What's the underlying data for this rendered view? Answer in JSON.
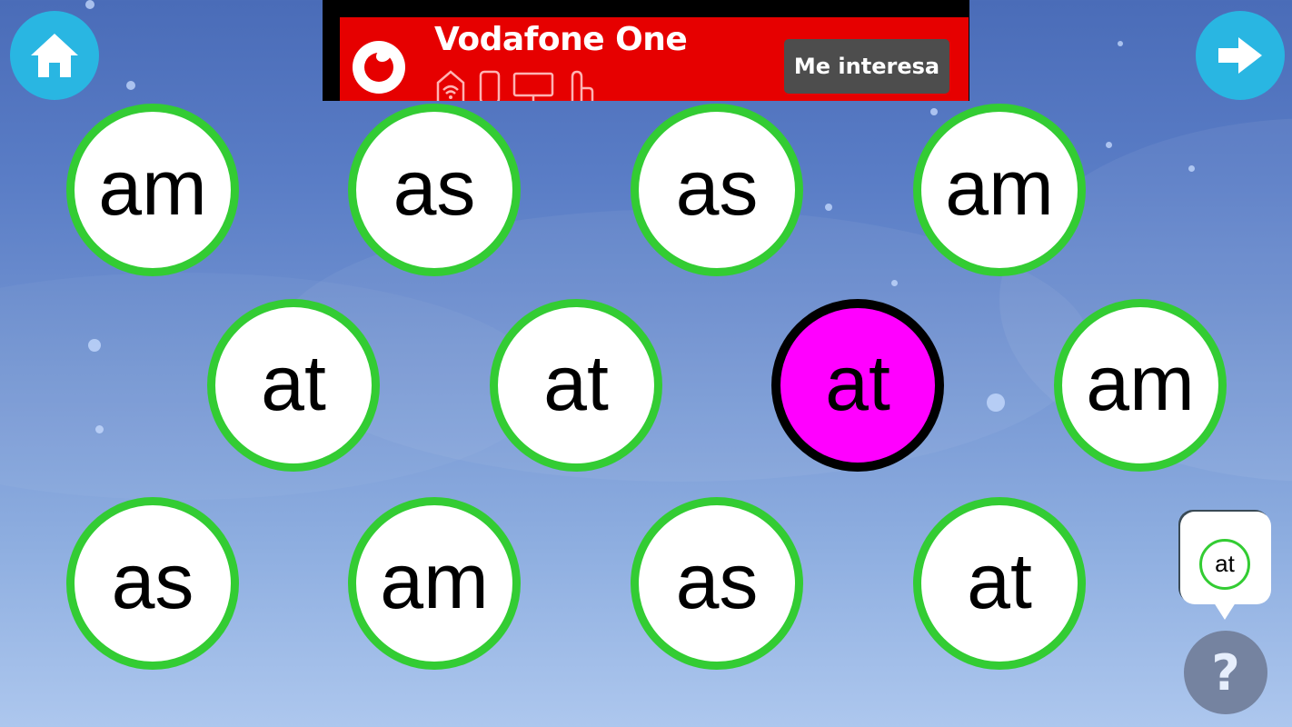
{
  "nav": {
    "home_icon": "home-icon",
    "next_icon": "arrow-right-icon"
  },
  "ad": {
    "brand_icon": "vodafone-logo-icon",
    "title": "Vodafone One",
    "product_icons": [
      "wifi-router-icon",
      "mobile-phone-icon",
      "tv-icon",
      "landline-phone-icon"
    ],
    "cta_label": "Me interesa",
    "colors": {
      "background": "#e60000",
      "cta": "#4d4d4d"
    }
  },
  "board": {
    "rows": [
      [
        {
          "label": "am",
          "selected": false
        },
        {
          "label": "as",
          "selected": false
        },
        {
          "label": "as",
          "selected": false
        },
        {
          "label": "am",
          "selected": false
        }
      ],
      [
        {
          "label": "at",
          "selected": false
        },
        {
          "label": "at",
          "selected": false
        },
        {
          "label": "at",
          "selected": true
        },
        {
          "label": "am",
          "selected": false
        }
      ],
      [
        {
          "label": "as",
          "selected": false
        },
        {
          "label": "am",
          "selected": false
        },
        {
          "label": "as",
          "selected": false
        },
        {
          "label": "at",
          "selected": false
        }
      ]
    ],
    "colors": {
      "ring": "#33cc33",
      "selected_fill": "#ff00ff",
      "selected_ring": "#000000"
    }
  },
  "hint": {
    "target_label": "at",
    "help_label": "?",
    "help_icon": "question-mark-icon"
  }
}
